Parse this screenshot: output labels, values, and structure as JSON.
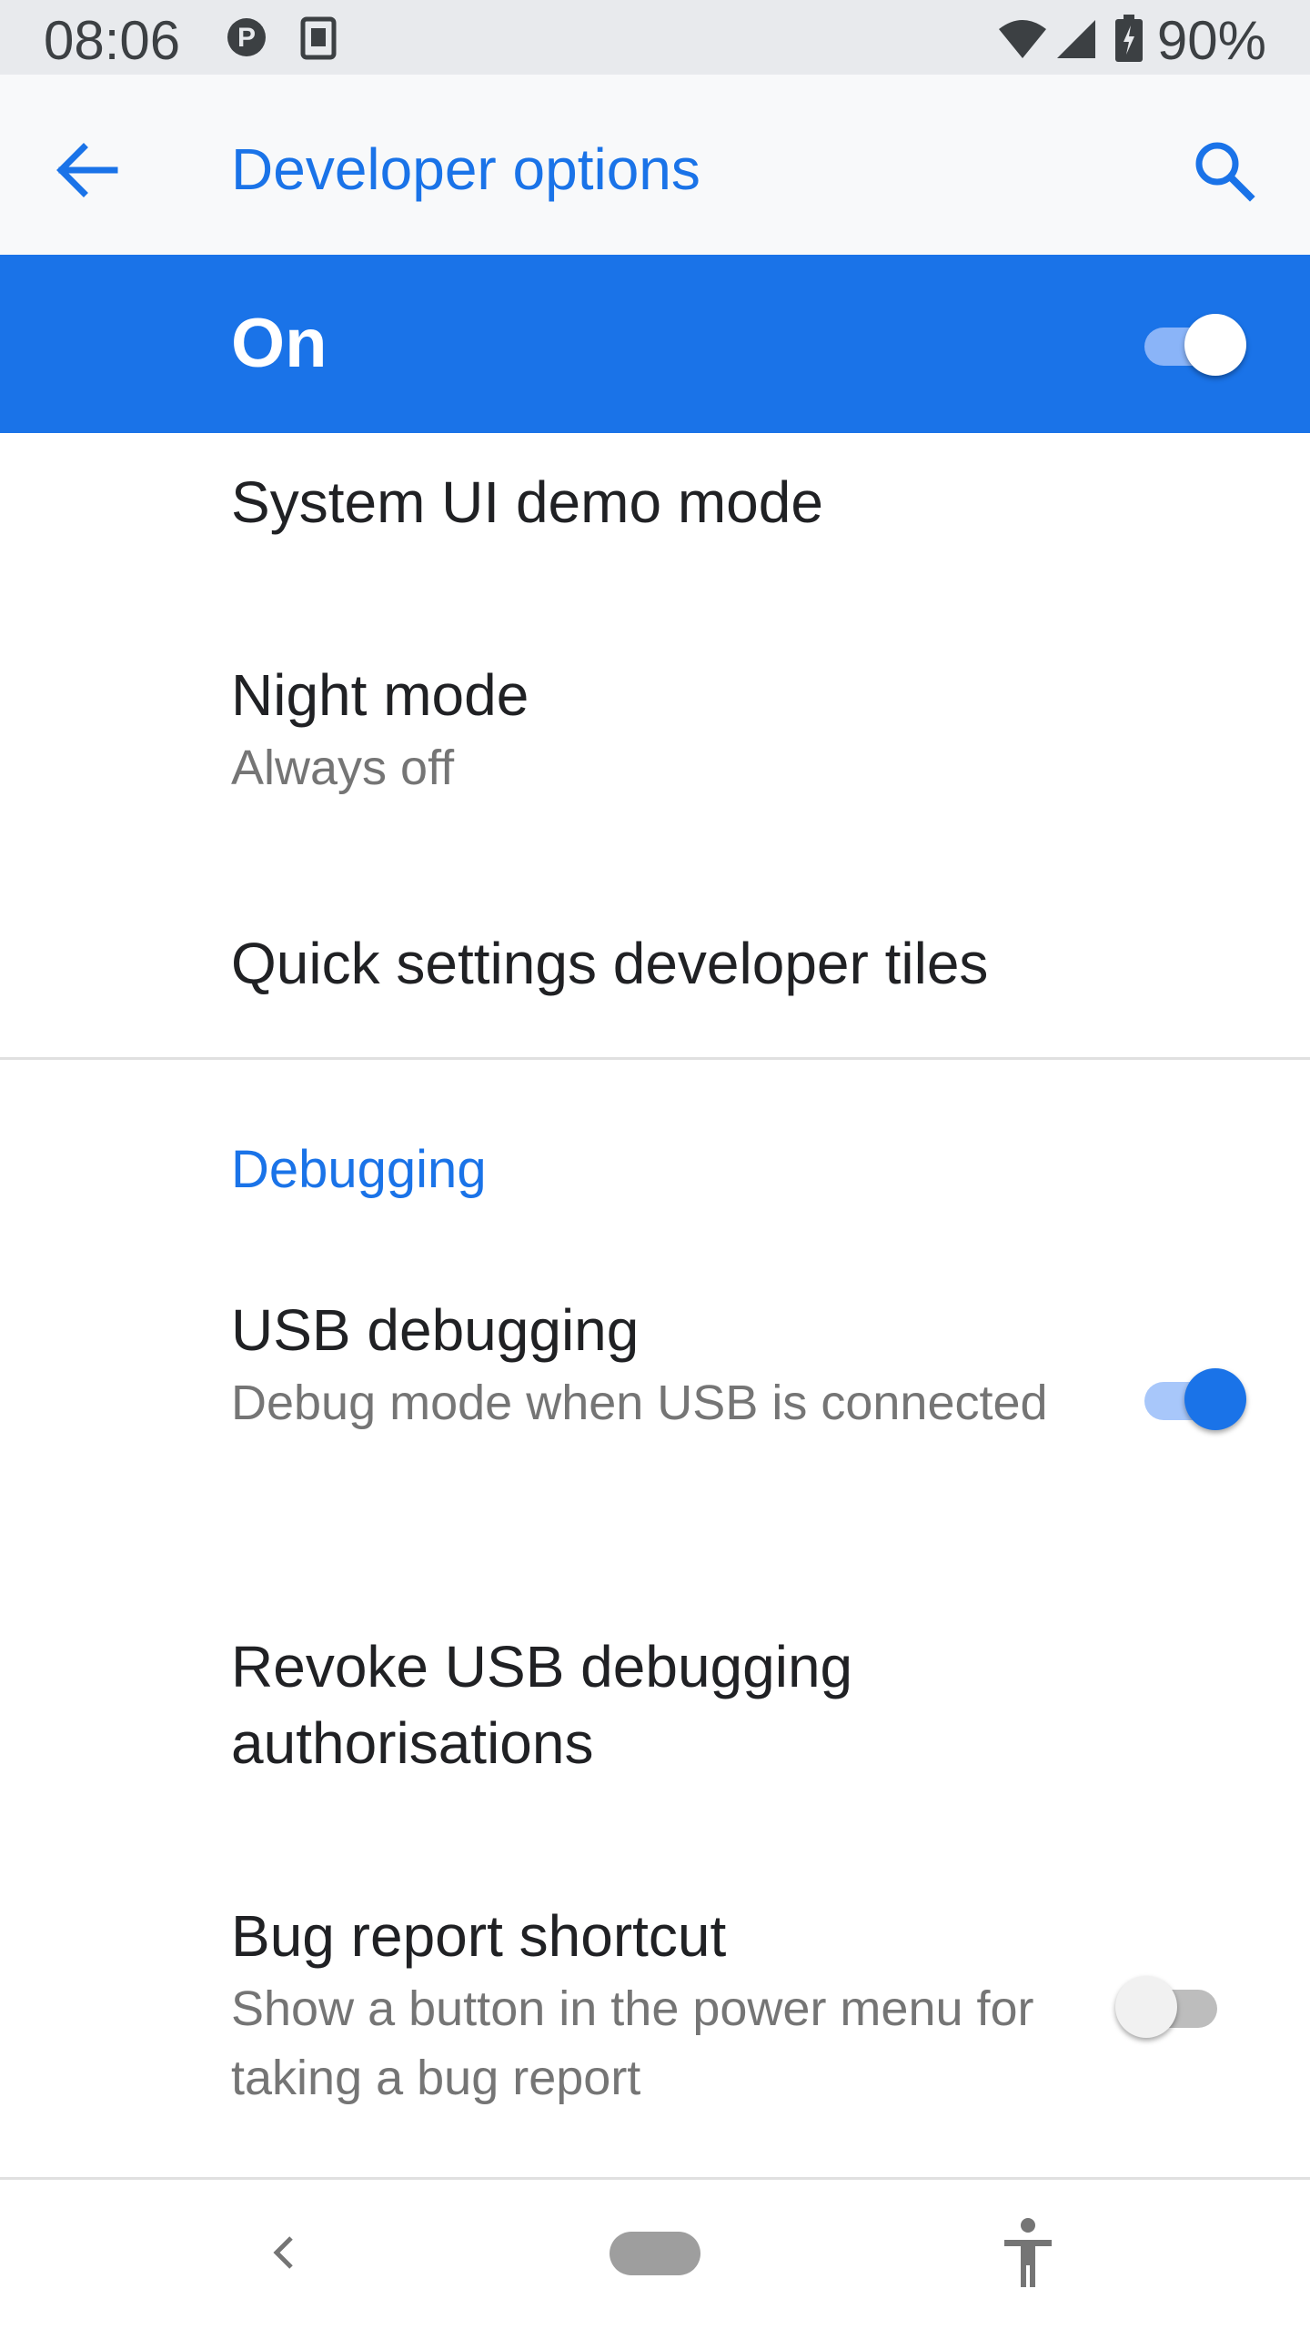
{
  "status_bar": {
    "time": "08:06",
    "battery": "90%",
    "icons": [
      "parking-icon",
      "sim-icon",
      "wifi-icon",
      "signal-icon",
      "battery-icon"
    ]
  },
  "app_bar": {
    "title": "Developer options",
    "back_icon": "arrow-left-icon",
    "search_icon": "search-icon"
  },
  "master_switch": {
    "label": "On",
    "checked": true
  },
  "items": [
    {
      "title": "System UI demo mode"
    },
    {
      "title": "Night mode",
      "summary": "Always off"
    },
    {
      "title": "Quick settings developer tiles"
    }
  ],
  "debugging": {
    "header": "Debugging",
    "usb_debugging": {
      "title": "USB debugging",
      "summary": "Debug mode when USB is connected",
      "checked": true
    },
    "revoke": {
      "title": "Revoke USB debugging authorisations"
    },
    "bug_report": {
      "title": "Bug report shortcut",
      "summary": "Show a button in the power menu for taking a bug report",
      "checked": false
    }
  },
  "nav_bar": {
    "icons": [
      "nav-back-icon",
      "nav-home-pill",
      "accessibility-icon"
    ]
  },
  "colors": {
    "accent": "#1a73e8",
    "status_bar_bg": "#e8eaed",
    "app_bar_bg": "#f8f9fa",
    "summary_text": "#757575"
  }
}
